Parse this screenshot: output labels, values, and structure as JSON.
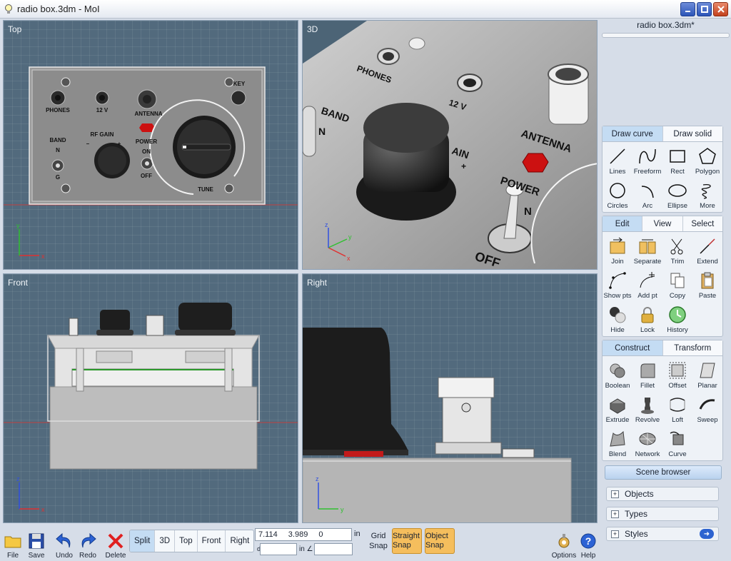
{
  "window": {
    "title": "radio box.3dm - MoI",
    "buttons": [
      "minimize",
      "maximize",
      "close"
    ]
  },
  "viewports": {
    "top": {
      "label": "Top",
      "labels": {
        "phones": "PHONES",
        "v12": "12 V",
        "antenna": "ANTENNA",
        "key": "KEY",
        "band": "BAND",
        "n": "N",
        "g": "G",
        "rf_gain": "RF GAIN",
        "minus": "–",
        "plus": "+",
        "power": "POWER",
        "on": "ON",
        "off": "OFF",
        "tune": "TUNE"
      },
      "axis_x": "x",
      "axis_y": "y"
    },
    "threed": {
      "label": "3D",
      "labels": {
        "phones": "PHONES",
        "v12": "12 V",
        "band": "BAND",
        "n": "N",
        "ain": "AIN",
        "antenna": "ANTENNA",
        "power": "POWER",
        "on": "N",
        "off": "OFF",
        "plus": "+"
      },
      "axis_x": "x",
      "axis_y": "y",
      "axis_z": "z"
    },
    "front": {
      "label": "Front",
      "axis_x": "x",
      "axis_z": "z"
    },
    "right": {
      "label": "Right",
      "axis_y": "y",
      "axis_z": "z"
    }
  },
  "panel": {
    "filename": "radio box.3dm*",
    "draw_tabs": [
      "Draw curve",
      "Draw solid"
    ],
    "draw_tools": [
      "Lines",
      "Freeform",
      "Rect",
      "Polygon",
      "Circles",
      "Arc",
      "Ellipse",
      "More"
    ],
    "edit_tabs": [
      "Edit",
      "View",
      "Select"
    ],
    "edit_tools": [
      "Join",
      "Separate",
      "Trim",
      "Extend",
      "Show pts",
      "Add pt",
      "Copy",
      "Paste",
      "Hide",
      "Lock",
      "History"
    ],
    "construct_tabs": [
      "Construct",
      "Transform"
    ],
    "construct_tools": [
      "Boolean",
      "Fillet",
      "Offset",
      "Planar",
      "Extrude",
      "Revolve",
      "Loft",
      "Sweep",
      "Blend",
      "Network",
      "Curve"
    ],
    "scene_browser": "Scene browser",
    "scene_items": [
      "Objects",
      "Types",
      "Styles"
    ]
  },
  "bottom": {
    "file": "File",
    "save": "Save",
    "undo": "Undo",
    "redo": "Redo",
    "delete": "Delete",
    "view_tabs": [
      "Split",
      "3D",
      "Top",
      "Front",
      "Right"
    ],
    "coord_x": "7.114",
    "coord_y": "3.989",
    "coord_z": "0",
    "coord_unit": "in",
    "d_label": "d",
    "in_label": "in ∠",
    "grid_snap": "Grid Snap",
    "straight_snap": "Straight Snap",
    "object_snap": "Object Snap",
    "options": "Options",
    "help": "Help"
  },
  "colors": {
    "accent": "#c4dcf3",
    "snap": "#f5be5d",
    "viewport": "#526a7d",
    "axis_x": "#e03030",
    "axis_y": "#30c030",
    "axis_z": "#3050e0",
    "power_button": "#d01010"
  }
}
